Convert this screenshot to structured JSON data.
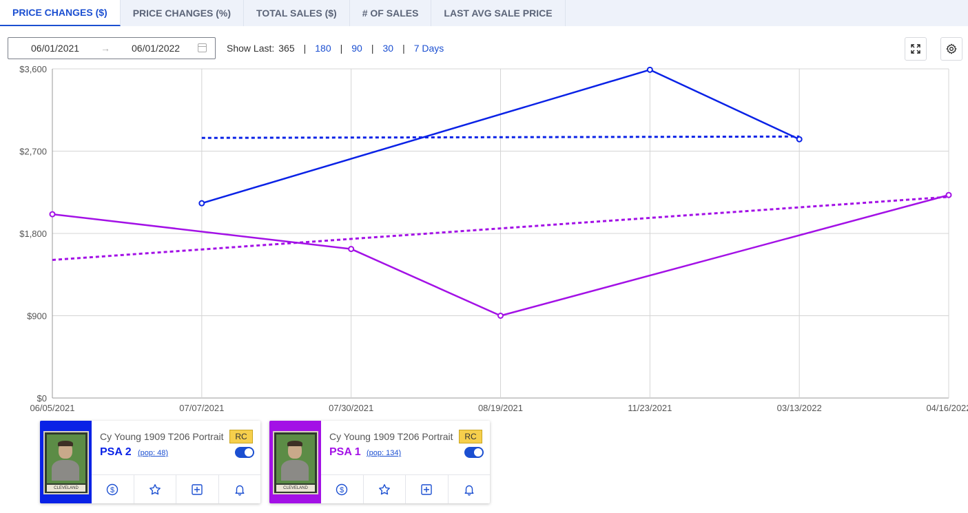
{
  "tabs": [
    {
      "label": "PRICE CHANGES ($)",
      "active": true
    },
    {
      "label": "PRICE CHANGES (%)",
      "active": false
    },
    {
      "label": "TOTAL SALES ($)",
      "active": false
    },
    {
      "label": "# OF SALES",
      "active": false
    },
    {
      "label": "LAST AVG SALE PRICE",
      "active": false
    }
  ],
  "date_range": {
    "start": "06/01/2021",
    "arrow": "→",
    "end": "06/01/2022"
  },
  "show_last": {
    "label": "Show Last:",
    "current": "365",
    "separator": "|",
    "options": [
      "180",
      "90",
      "30",
      "7 Days"
    ]
  },
  "toolbar": {
    "fullscreen_icon": "expand-icon",
    "settings_icon": "gear-icon"
  },
  "colors": {
    "accent": "#1b4fd1",
    "series_psa2": "#0a22e6",
    "series_psa1": "#a311e6",
    "rc_badge": "#f6cf4c"
  },
  "chart_data": {
    "type": "line",
    "x": [
      "06/05/2021",
      "07/07/2021",
      "07/30/2021",
      "08/19/2021",
      "11/23/2021",
      "03/13/2022",
      "04/16/2022"
    ],
    "y_ticks": [
      "$0",
      "$900",
      "$1,800",
      "$2,700",
      "$3,600"
    ],
    "ylim": [
      0,
      3600
    ],
    "grid": true,
    "series": [
      {
        "color": "#0a22e6",
        "points": [
          {
            "x": "07/07/2021",
            "y": 2130
          },
          {
            "x": "11/23/2021",
            "y": 3590
          },
          {
            "x": "03/13/2022",
            "y": 2830
          }
        ],
        "trend": {
          "from": {
            "x": "07/07/2021",
            "y": 2845
          },
          "to": {
            "x": "03/13/2022",
            "y": 2860
          }
        }
      },
      {
        "color": "#a311e6",
        "points": [
          {
            "x": "06/05/2021",
            "y": 2010
          },
          {
            "x": "07/30/2021",
            "y": 1630
          },
          {
            "x": "08/19/2021",
            "y": 900
          },
          {
            "x": "04/16/2022",
            "y": 2220
          }
        ],
        "trend": {
          "from": {
            "x": "06/05/2021",
            "y": 1510
          },
          "to": {
            "x": "04/16/2022",
            "y": 2200
          }
        }
      }
    ]
  },
  "cards": [
    {
      "title": "Cy Young 1909 T206 Portrait",
      "badge": "RC",
      "grade": "PSA 2",
      "pop": "(pop: 48)",
      "color": "#0a22e6",
      "card_caption": "CLEVELAND",
      "toggle_on": true,
      "actions": [
        "dollar-icon",
        "star-icon",
        "add-icon",
        "bell-icon"
      ]
    },
    {
      "title": "Cy Young 1909 T206 Portrait",
      "badge": "RC",
      "grade": "PSA 1",
      "pop": "(pop: 134)",
      "color": "#a311e6",
      "card_caption": "CLEVELAND",
      "toggle_on": true,
      "actions": [
        "dollar-icon",
        "star-icon",
        "add-icon",
        "bell-icon"
      ]
    }
  ]
}
